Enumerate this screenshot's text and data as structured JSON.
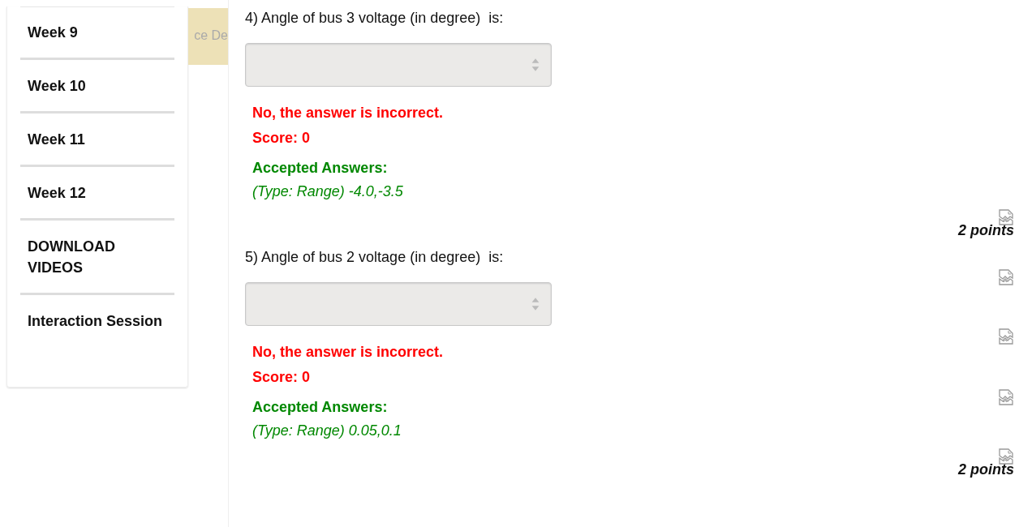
{
  "sidebar": {
    "items": [
      {
        "label": "Week 9"
      },
      {
        "label": "Week 10"
      },
      {
        "label": "Week 11"
      },
      {
        "label": "Week 12"
      },
      {
        "label": "DOWNLOAD VIDEOS"
      },
      {
        "label": "Interaction Session"
      }
    ]
  },
  "banner": {
    "text": "ce De"
  },
  "questions": [
    {
      "text": "4) Angle of bus 3 voltage (in degree)  is:",
      "verdict": "No, the answer is incorrect.",
      "score": "Score: 0",
      "accepted_label": "Accepted Answers:",
      "accepted": "(Type: Range) -4.0,-3.5",
      "points": "2 points"
    },
    {
      "text": "5) Angle of bus 2 voltage (in degree)  is:",
      "verdict": "No, the answer is incorrect.",
      "score": "Score: 0",
      "accepted_label": "Accepted Answers:",
      "accepted": "(Type: Range) 0.05,0.1",
      "points": "2 points"
    }
  ]
}
